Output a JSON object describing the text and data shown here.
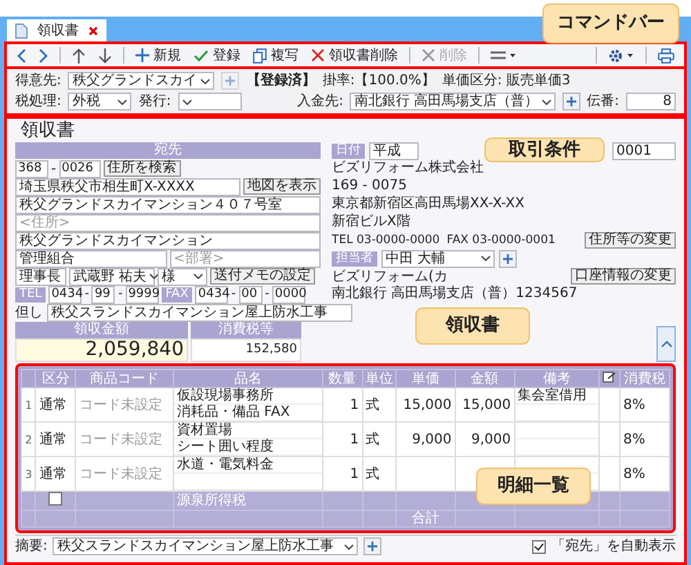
{
  "tab": {
    "label": "領収書",
    "selected": true
  },
  "command_bar": {
    "buttons": [
      {
        "kind": "prev"
      },
      {
        "kind": "next"
      },
      {
        "kind": "sep"
      },
      {
        "kind": "up"
      },
      {
        "kind": "down"
      },
      {
        "kind": "sep"
      },
      {
        "kind": "new",
        "label": "新規",
        "disabled": false
      },
      {
        "kind": "register",
        "label": "登録",
        "disabled": false
      },
      {
        "kind": "copy",
        "label": "複写",
        "disabled": false
      },
      {
        "kind": "delete",
        "label": "領収書削除",
        "disabled": false
      },
      {
        "kind": "sep"
      },
      {
        "kind": "clear",
        "label": "削除",
        "disabled": true
      },
      {
        "kind": "sep"
      },
      {
        "kind": "menu"
      }
    ],
    "right_buttons": [
      {
        "kind": "settings"
      },
      {
        "kind": "print"
      }
    ]
  },
  "conditions": {
    "customer_label": "得意先:",
    "customer": "秩父グランドスカイ",
    "status": "【登録済】",
    "rate": "掛率:【100.0%】",
    "price_class": "単価区分: 販売単価3",
    "deposit_label": "入金先:",
    "deposit": "南北銀行 高田馬場支店（普）",
    "tax_label": "税処理:",
    "tax": "外税",
    "issue_label": "発行:",
    "slip_label": "伝番:",
    "slip": "8"
  },
  "receipt": {
    "title": "領収書",
    "recipient_header": "宛先",
    "zip1": "368",
    "zip_sep": "-",
    "zip2": "0026",
    "search_button": "住所を検索",
    "address1": "埼玉県秩父市相生町X-XXXX",
    "map_button": "地図を表示",
    "address2": "秩父グランドスカイマンション４０７号室",
    "address3_placeholder": "<住所>",
    "name": "秩父グランドスカイマンション",
    "org": "管理組合",
    "dept_placeholder": "<部署>",
    "title_field": "理事長",
    "person": "武蔵野 祐夫",
    "honorific": "様",
    "memo_button": "送付メモの設定",
    "tel_label": "TEL",
    "tel": [
      "0434",
      "99",
      "9999"
    ],
    "fax_label": "FAX",
    "fax": [
      "0434",
      "00",
      "0000"
    ],
    "memo_label": "但し",
    "memo": "秩父スランドスカイマンション屋上防水工事",
    "date_label": "日付",
    "date": "平成",
    "number": "0001",
    "company": "ビズリフォーム株式会社",
    "company_zip": "169 - 0075",
    "company_address": "東京都新宿区高田馬場XX-X-XX",
    "company_building": "新宿ビルX階",
    "company_tel": "TEL 03-0000-0000",
    "company_fax": "FAX 03-0000-0001",
    "address_change_button": "住所等の変更",
    "staff_label": "担当者",
    "staff": "中田 大輔",
    "account_name": "ビズリフォーム(カ",
    "account_button": "口座情報の変更",
    "account": "南北銀行 高田馬場支店（普）1234567",
    "amount_label": "領収金額",
    "amount": "2,059,840",
    "tax_label": "消費税等",
    "tax": "152,580"
  },
  "table": {
    "columns": [
      "区分",
      "商品コード",
      "品名",
      "数量",
      "単位",
      "単価",
      "金額",
      "備考",
      "消費税"
    ],
    "rows": [
      {
        "no": "1",
        "category": "通常",
        "code": "コード未設定",
        "names": [
          "仮設現場事務所",
          "消耗品・備品 FAX"
        ],
        "qty": "1",
        "unit": "式",
        "price": "15,000",
        "amount": "15,000",
        "notes": [
          "集会室借用"
        ],
        "tax": "8%"
      },
      {
        "no": "2",
        "category": "通常",
        "code": "コード未設定",
        "names": [
          "資材置場",
          "シート囲い程度"
        ],
        "qty": "1",
        "unit": "式",
        "price": "9,000",
        "amount": "9,000",
        "notes": [],
        "tax": "8%"
      },
      {
        "no": "3",
        "category": "通常",
        "code": "コード未設定",
        "names": [
          "水道・電気料金"
        ],
        "qty": "1",
        "unit": "式",
        "notes": [],
        "tax": "8%"
      }
    ],
    "withholding": {
      "checked": false,
      "label": "源泉所得税"
    },
    "total_label": "合計"
  },
  "footer": {
    "summary_label": "摘要:",
    "summary": "秩父スランドスカイマンション屋上防水工事",
    "auto_show": {
      "checked": true,
      "label": "「宛先」を自動表示"
    }
  },
  "callouts": [
    {
      "label": "コマンドバー"
    },
    {
      "label": "取引条件"
    },
    {
      "label": "領収書"
    },
    {
      "label": "明細一覧"
    }
  ]
}
